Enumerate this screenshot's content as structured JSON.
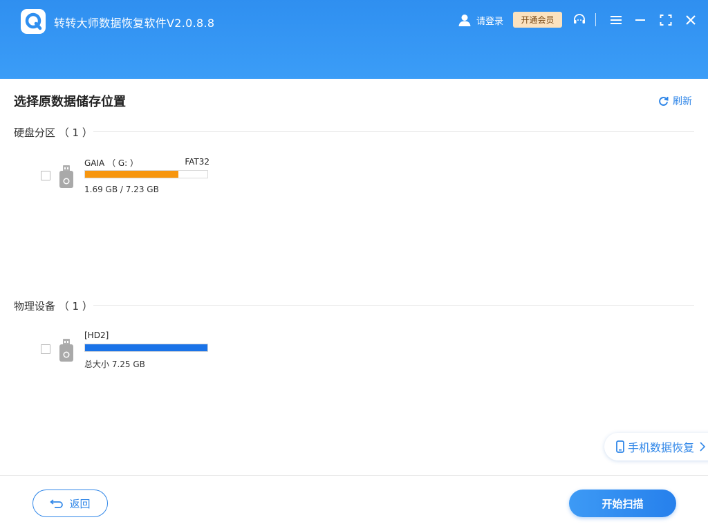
{
  "header": {
    "app_title": "转转大师数据恢复软件V2.0.8.8",
    "login_label": "请登录",
    "vip_label": "开通会员",
    "icons": [
      "logo-icon",
      "user-icon",
      "headset-icon",
      "menu-icon",
      "minimize-icon",
      "maximize-icon",
      "close-icon"
    ]
  },
  "main": {
    "page_title": "选择原数据储存位置",
    "refresh_label": "刷新",
    "sections": [
      {
        "title": "硬盘分区 （ 1 ）",
        "drives": [
          {
            "name": "GAIA （ G: ）",
            "filesystem": "FAT32",
            "size_text": "1.69 GB / 7.23 GB",
            "usage": 0.76,
            "bar_color": "#f7960f"
          }
        ]
      },
      {
        "title": "物理设备 （ 1 ）",
        "drives": [
          {
            "name": "[HD2]",
            "filesystem": "",
            "size_text": "总大小 7.25 GB",
            "usage": 1.0,
            "bar_color": "#1a73e8"
          }
        ]
      }
    ]
  },
  "phone_recovery": {
    "label": "手机数据恢复"
  },
  "footer": {
    "back_label": "返回",
    "scan_label": "开始扫描"
  },
  "colors": {
    "header": "#3b9af5",
    "accent": "#2f86e8",
    "vip_bg": "#fbe2bf",
    "usage_orange": "#f7960f",
    "usage_blue": "#1a73e8"
  }
}
